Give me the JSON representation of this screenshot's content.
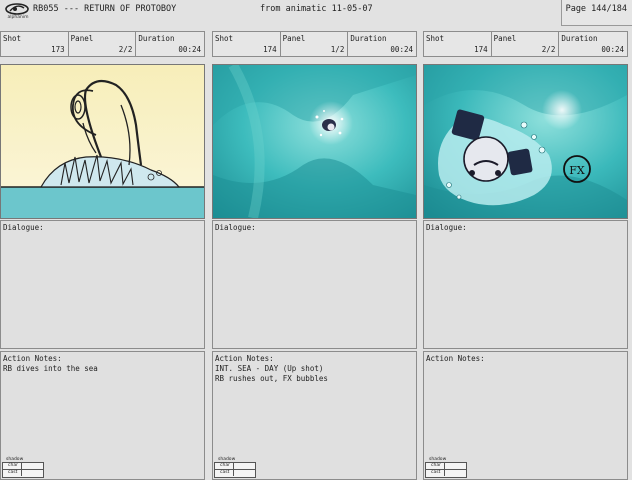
{
  "header": {
    "logo_text": "alphanim",
    "production": "RB055 --- RETURN OF PROTOBOY",
    "source": "from animatic 11-05-07",
    "page": "Page 144/184"
  },
  "labels": {
    "shot": "Shot",
    "panel": "Panel",
    "duration": "Duration",
    "dialogue": "Dialogue:",
    "action_notes": "Action Notes:",
    "shadow": "shadow",
    "char": "char",
    "cast": "cast"
  },
  "panels": [
    {
      "shot": "173",
      "panel": "2/2",
      "duration": "00:24",
      "dialogue": "",
      "action_notes": [
        "RB dives into the sea"
      ]
    },
    {
      "shot": "174",
      "panel": "1/2",
      "duration": "00:24",
      "dialogue": "",
      "action_notes": [
        "INT. SEA - DAY (Up shot)",
        "RB rushes out, FX bubbles"
      ]
    },
    {
      "shot": "174",
      "panel": "2/2",
      "duration": "00:24",
      "dialogue": "",
      "action_notes": []
    }
  ],
  "colors": {
    "sky": "#f7efc2",
    "sea": "#3fbcc0",
    "sea_deep": "#1f8f95"
  }
}
